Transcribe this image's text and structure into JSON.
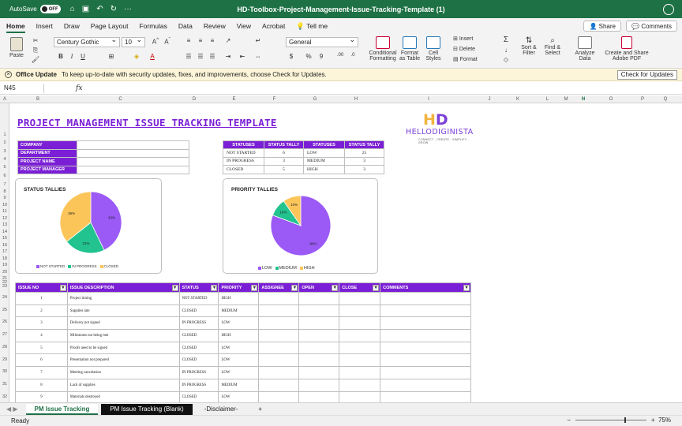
{
  "titlebar": {
    "autosave_label": "AutoSave",
    "autosave_state": "OFF",
    "title": "HD-Toolbox-Project-Management-Issue-Tracking-Template (1)"
  },
  "tabs": [
    "Home",
    "Insert",
    "Draw",
    "Page Layout",
    "Formulas",
    "Data",
    "Review",
    "View",
    "Acrobat"
  ],
  "tell_me": "Tell me",
  "share_label": "Share",
  "comments_label": "Comments",
  "ribbon": {
    "paste": "Paste",
    "font_name": "Century Gothic",
    "font_size": "10",
    "number_format": "General",
    "conditional_formatting": "Conditional Formatting",
    "format_as_table": "Format as Table",
    "cell_styles": "Cell Styles",
    "insert": "Insert",
    "delete": "Delete",
    "format": "Format",
    "sort_filter": "Sort & Filter",
    "find_select": "Find & Select",
    "analyze_data": "Analyze Data",
    "create_share": "Create and Share Adobe PDF"
  },
  "notice": {
    "bold": "Office Update",
    "text": "To keep up-to-date with security updates, fixes, and improvements, choose Check for Updates.",
    "button": "Check for Updates"
  },
  "formula_bar": {
    "name_box": "N45",
    "fx": "fx"
  },
  "columns": [
    "A",
    "B",
    "C",
    "D",
    "E",
    "F",
    "G",
    "H",
    "I",
    "J",
    "K",
    "L",
    "M",
    "N",
    "O",
    "P",
    "Q",
    "R",
    "S"
  ],
  "selected_column": "N",
  "rows": [
    "1",
    "2",
    "3",
    "4",
    "5",
    "6",
    "7",
    "8",
    "9",
    "10",
    "11",
    "12",
    "13",
    "14",
    "15",
    "16",
    "17",
    "18",
    "19",
    "20",
    "21",
    "22",
    "23",
    "24",
    "25",
    "26",
    "27",
    "28",
    "29",
    "30",
    "31",
    "32"
  ],
  "sheet": {
    "title": "PROJECT MANAGEMENT ISSUE TRACKING TEMPLATE",
    "logo": {
      "mark_h": "H",
      "mark_d": "D",
      "brand": "HELLODIGINISTA",
      "tagline": "CONNECT - CREATE - SIMPLIFY - GROW"
    },
    "info_labels": [
      "COMPANY",
      "DEPARTMENT",
      "PROJECT NAME",
      "PROJECT MANAGER"
    ],
    "status_headers": [
      "STATUSES",
      "STATUS TALLY",
      "STATUSES",
      "STATUS TALLY"
    ],
    "status_rows": [
      [
        "NOT STARTED",
        "6",
        "LOW",
        "25"
      ],
      [
        "IN PROGRESS",
        "3",
        "MEDIUM",
        "3"
      ],
      [
        "CLOSED",
        "5",
        "HIGH",
        "3"
      ]
    ],
    "status_chart": {
      "title": "STATUS TALLIES",
      "labels": [
        "NOT STARTED",
        "IN PROGRESS",
        "CLOSED"
      ],
      "slice_labels": [
        "43%",
        "21%",
        "36%"
      ]
    },
    "priority_chart": {
      "title": "PRIORITY TALLIES",
      "labels": [
        "LOW",
        "MEDIUM",
        "HIGH"
      ],
      "slice_labels": [
        "80%",
        "10%",
        "10%"
      ]
    },
    "issue_headers": [
      "ISSUE NO",
      "ISSUE DESCRIPTION",
      "STATUS",
      "PRIORITY",
      "ASSIGNEE",
      "OPEN",
      "CLOSE",
      "COMMENTS"
    ],
    "issues": [
      [
        "1",
        "Project timing",
        "NOT STARTED",
        "HIGH"
      ],
      [
        "2",
        "Supplies late",
        "CLOSED",
        "MEDIUM"
      ],
      [
        "3",
        "Delivery not signed",
        "IN PROGRESS",
        "LOW"
      ],
      [
        "4",
        "Milestones not being met",
        "CLOSED",
        "HIGH"
      ],
      [
        "5",
        "Proofs need to be signed",
        "CLOSED",
        "LOW"
      ],
      [
        "6",
        "Presentation not prepared",
        "CLOSED",
        "LOW"
      ],
      [
        "7",
        "Meeting cancelation",
        "IN PROGRESS",
        "LOW"
      ],
      [
        "8",
        "Lack of supplies",
        "IN PROGRESS",
        "MEDIUM"
      ],
      [
        "9",
        "Materials destroyed",
        "CLOSED",
        "LOW"
      ]
    ]
  },
  "chart_data": [
    {
      "type": "pie",
      "title": "STATUS TALLIES",
      "categories": [
        "NOT STARTED",
        "IN PROGRESS",
        "CLOSED"
      ],
      "values": [
        6,
        3,
        5
      ],
      "percent_labels": [
        "43%",
        "21%",
        "36%"
      ],
      "colors": [
        "#9b59f5",
        "#22c38e",
        "#fbc55a"
      ],
      "legend": "bottom"
    },
    {
      "type": "pie",
      "title": "PRIORITY TALLIES",
      "categories": [
        "LOW",
        "MEDIUM",
        "HIGH"
      ],
      "values": [
        25,
        3,
        3
      ],
      "percent_labels": [
        "80%",
        "10%",
        "10%"
      ],
      "colors": [
        "#9b59f5",
        "#22c38e",
        "#fbc55a"
      ],
      "legend": "bottom"
    }
  ],
  "sheet_tabs": [
    "PM Issue Tracking",
    "PM Issue Tracking (Blank)",
    "-Disclaimer-"
  ],
  "status_bar": {
    "ready": "Ready",
    "zoom": "75%"
  },
  "colors": {
    "excel_green": "#1e7145",
    "header_purple": "#7b1fd6"
  }
}
